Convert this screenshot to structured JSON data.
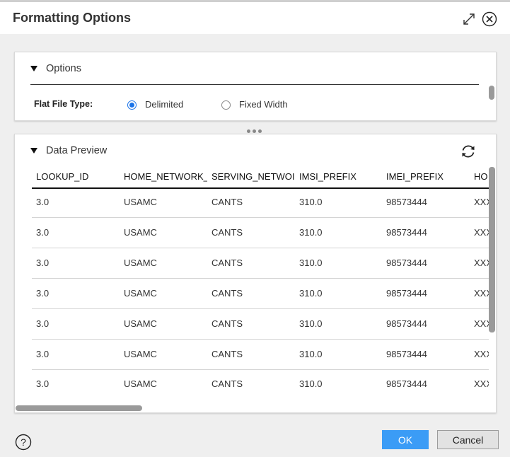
{
  "dialog": {
    "title": "Formatting Options",
    "expand_icon": "expand-icon",
    "close_icon": "close-icon"
  },
  "options": {
    "section_label": "Options",
    "flat_file_type_label": "Flat File Type:",
    "radio_options": [
      {
        "label": "Delimited",
        "selected": true
      },
      {
        "label": "Fixed Width",
        "selected": false
      }
    ]
  },
  "preview": {
    "section_label": "Data Preview",
    "refresh_icon": "refresh-icon",
    "columns": [
      "LOOKUP_ID",
      "HOME_NETWORK_",
      "SERVING_NETWOI",
      "IMSI_PREFIX",
      "IMEI_PREFIX",
      "HO"
    ],
    "rows": [
      [
        "3.0",
        "USAMC",
        "CANTS",
        "310.0",
        "98573444",
        "XXX"
      ],
      [
        "3.0",
        "USAMC",
        "CANTS",
        "310.0",
        "98573444",
        "XXX"
      ],
      [
        "3.0",
        "USAMC",
        "CANTS",
        "310.0",
        "98573444",
        "XXX"
      ],
      [
        "3.0",
        "USAMC",
        "CANTS",
        "310.0",
        "98573444",
        "XXX"
      ],
      [
        "3.0",
        "USAMC",
        "CANTS",
        "310.0",
        "98573444",
        "XXX"
      ],
      [
        "3.0",
        "USAMC",
        "CANTS",
        "310.0",
        "98573444",
        "XXX"
      ],
      [
        "3.0",
        "USAMC",
        "CANTS",
        "310.0",
        "98573444",
        "XXX"
      ]
    ]
  },
  "footer": {
    "help_icon": "help-icon",
    "ok_label": "OK",
    "cancel_label": "Cancel"
  },
  "colors": {
    "accent": "#3b9cf6",
    "radio_selected": "#1a73e8"
  }
}
